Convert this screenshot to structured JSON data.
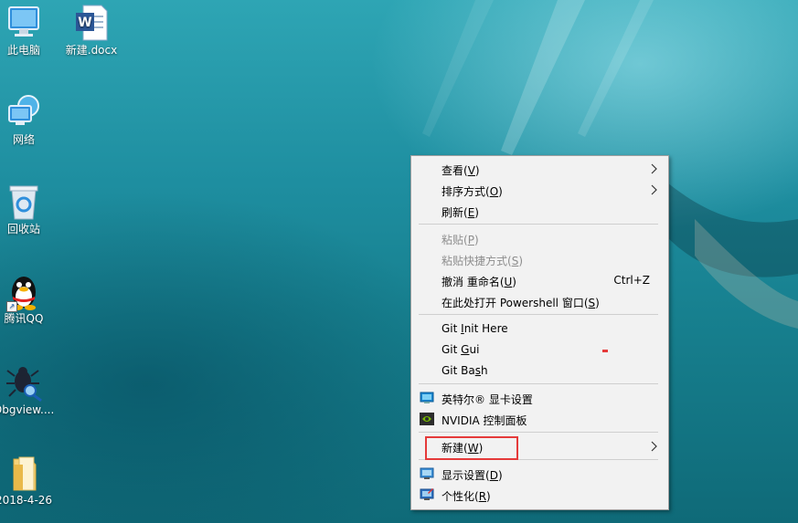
{
  "desktop_icons": [
    {
      "label": "此电脑",
      "icon": "computer-icon"
    },
    {
      "label": "新建.docx",
      "icon": "word-document-icon"
    },
    {
      "label": "网络",
      "icon": "network-icon"
    },
    {
      "label": "回收站",
      "icon": "recycle-bin-icon"
    },
    {
      "label": "腾讯QQ",
      "icon": "qq-penguin-icon"
    },
    {
      "label": "Dbgview....",
      "icon": "dbgview-icon"
    },
    {
      "label": "2018-4-26",
      "icon": "folder-icon"
    }
  ],
  "menu": {
    "view": {
      "label": "查看(V)",
      "pre": "查看(",
      "key": "V",
      "post": ")"
    },
    "sort": {
      "label": "排序方式(O)",
      "pre": "排序方式(",
      "key": "O",
      "post": ")"
    },
    "refresh": {
      "pre": "刷新(",
      "key": "E",
      "post": ")"
    },
    "paste": {
      "pre": "粘贴(",
      "key": "P",
      "post": ")"
    },
    "paste_shortcut": {
      "pre": "粘贴快捷方式(",
      "key": "S",
      "post": ")"
    },
    "undo_rename": {
      "pre": "撤消 重命名(",
      "key": "U",
      "post": ")",
      "shortcut": "Ctrl+Z"
    },
    "powershell": {
      "pre": "在此处打开 Powershell 窗口(",
      "key": "S",
      "post": ")"
    },
    "git_init": {
      "pre": "Git ",
      "key": "I",
      "post": "nit Here"
    },
    "git_gui": {
      "pre": "Git ",
      "key": "G",
      "post": "ui"
    },
    "git_bash": {
      "pre": "Git Ba",
      "key": "s",
      "post": "h"
    },
    "intel": {
      "label": "英特尔® 显卡设置"
    },
    "nvidia": {
      "label": "NVIDIA 控制面板"
    },
    "new": {
      "pre": "新建(",
      "key": "W",
      "post": ")"
    },
    "display": {
      "pre": "显示设置(",
      "key": "D",
      "post": ")"
    },
    "personalize": {
      "pre": "个性化(",
      "key": "R",
      "post": ")"
    }
  },
  "colors": {
    "highlight_box": "#e53a3a",
    "menu_bg": "#f2f2f2"
  }
}
